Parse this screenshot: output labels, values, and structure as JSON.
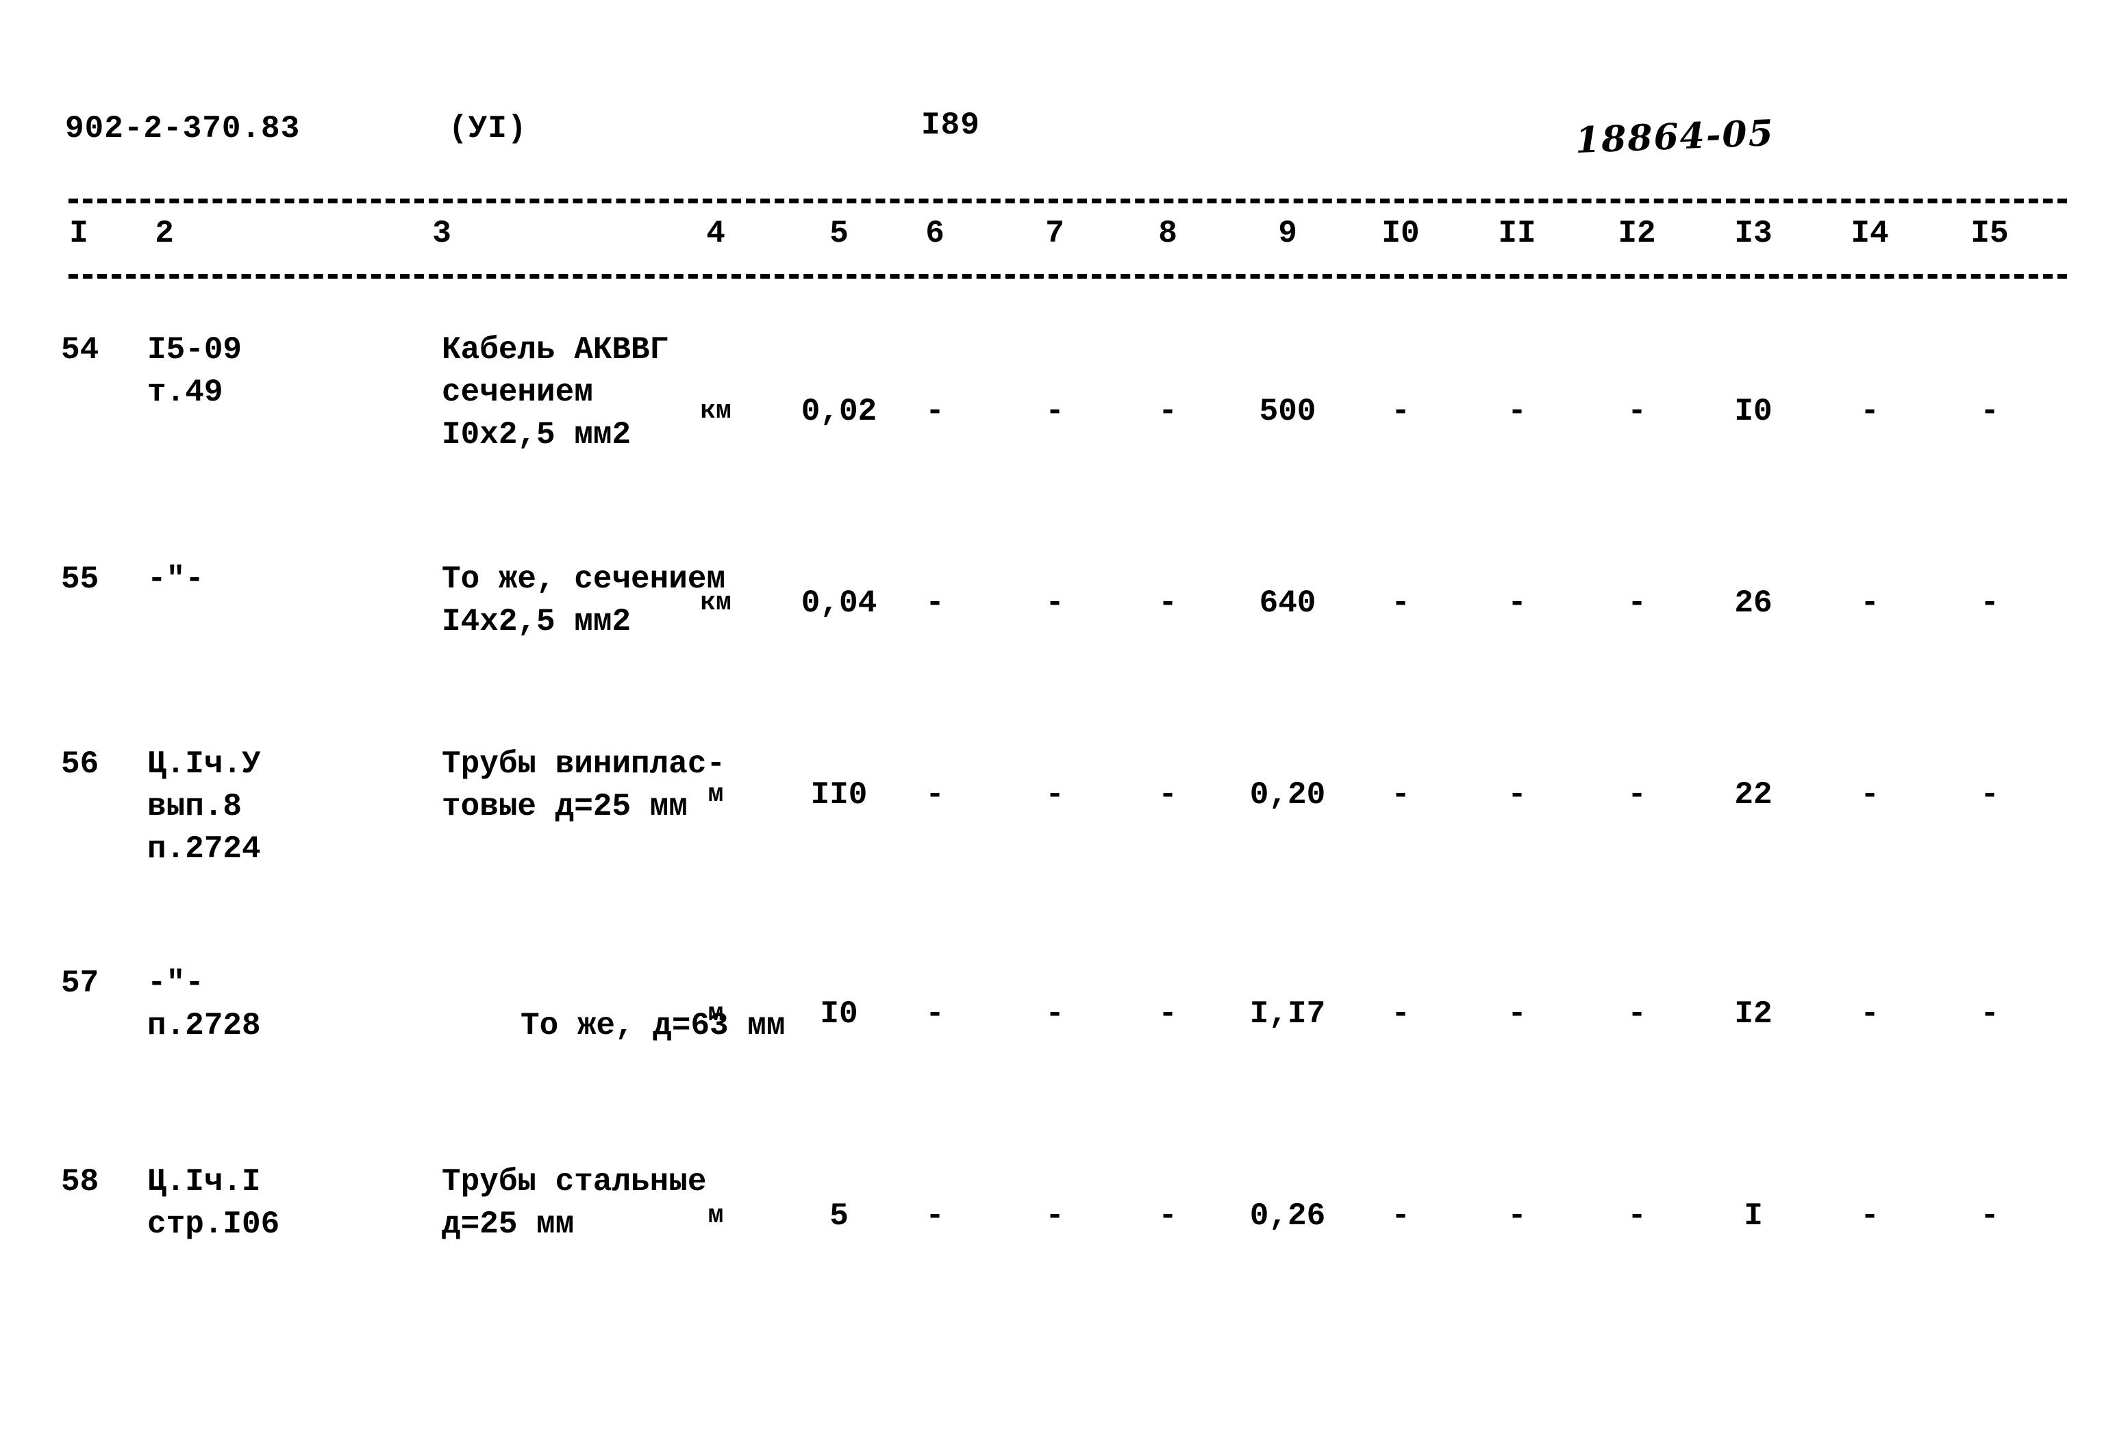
{
  "header": {
    "doc_code": "902-2-370.83",
    "doc_part": "(УI)",
    "page_number": "I89",
    "stamp": "18864-05"
  },
  "table": {
    "column_headers": [
      "I",
      "2",
      "3",
      "4",
      "5",
      "6",
      "7",
      "8",
      "9",
      "I0",
      "II",
      "I2",
      "I3",
      "I4",
      "I5"
    ],
    "rows": [
      {
        "c1": "54",
        "c2": [
          "I5-09",
          "т.49"
        ],
        "c3": [
          "Кабель АКВВГ",
          "сечением",
          "I0х2,5 мм2"
        ],
        "c4": "км",
        "c5": "0,02",
        "c6": "-",
        "c7": "-",
        "c8": "-",
        "c9": "500",
        "c10": "-",
        "c11": "-",
        "c12": "-",
        "c13": "I0",
        "c14": "-",
        "c15": "-"
      },
      {
        "c1": "55",
        "c2": [
          "-\"-"
        ],
        "c3": [
          "То же, сечением",
          "I4х2,5 мм2"
        ],
        "c4": "км",
        "c5": "0,04",
        "c6": "-",
        "c7": "-",
        "c8": "-",
        "c9": "640",
        "c10": "-",
        "c11": "-",
        "c12": "-",
        "c13": "26",
        "c14": "-",
        "c15": "-"
      },
      {
        "c1": "56",
        "c2": [
          "Ц.Iч.У",
          "вып.8",
          "п.2724"
        ],
        "c3": [
          "Трубы виниплас-",
          "товые д=25 мм"
        ],
        "c4": "м",
        "c5": "II0",
        "c6": "-",
        "c7": "-",
        "c8": "-",
        "c9": "0,20",
        "c10": "-",
        "c11": "-",
        "c12": "-",
        "c13": "22",
        "c14": "-",
        "c15": "-"
      },
      {
        "c1": "57",
        "c2": [
          "-\"-",
          "п.2728"
        ],
        "c3": [
          "То же, д=63 мм"
        ],
        "c4": "м",
        "c5": "I0",
        "c6": "-",
        "c7": "-",
        "c8": "-",
        "c9": "I,I7",
        "c10": "-",
        "c11": "-",
        "c12": "-",
        "c13": "I2",
        "c14": "-",
        "c15": "-"
      },
      {
        "c1": "58",
        "c2": [
          "Ц.Iч.I",
          "стр.I06"
        ],
        "c3": [
          "Трубы стальные",
          "д=25 мм"
        ],
        "c4": "м",
        "c5": "5",
        "c6": "-",
        "c7": "-",
        "c8": "-",
        "c9": "0,26",
        "c10": "-",
        "c11": "-",
        "c12": "-",
        "c13": "I",
        "c14": "-",
        "c15": "-"
      }
    ]
  }
}
